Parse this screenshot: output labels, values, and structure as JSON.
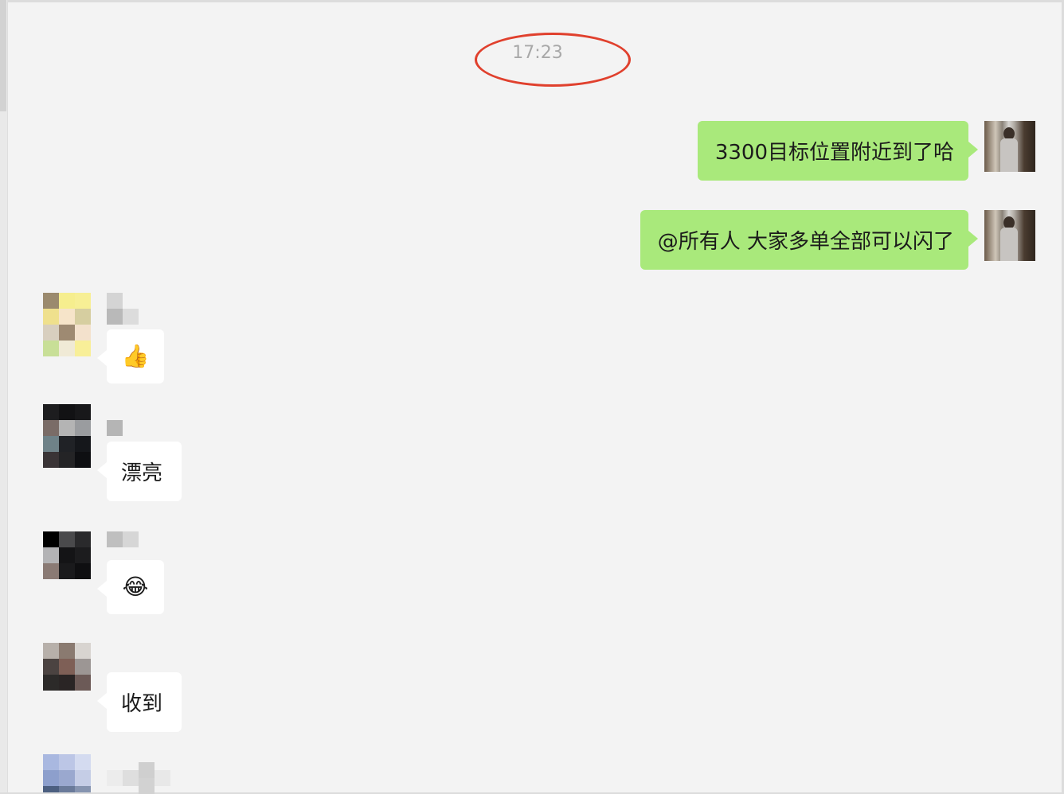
{
  "chat": {
    "timestamp": "17:23",
    "messages": [
      {
        "direction": "out",
        "text": "3300目标位置附近到了哈"
      },
      {
        "direction": "out",
        "text": "@所有人 大家多单全部可以闪了"
      },
      {
        "direction": "in",
        "type": "emoji",
        "emoji": "thumbs-up",
        "text": "👍"
      },
      {
        "direction": "in",
        "type": "text",
        "text": "漂亮"
      },
      {
        "direction": "in",
        "type": "emoji",
        "emoji": "face-with-tears-of-joy",
        "text": "😂"
      },
      {
        "direction": "in",
        "type": "text",
        "text": "收到"
      }
    ]
  },
  "colors": {
    "background": "#f3f3f3",
    "outgoing_bubble": "#a9e97b",
    "incoming_bubble": "#ffffff",
    "timestamp_text": "#a8a8a8",
    "annotation_ellipse": "#e0402d"
  }
}
